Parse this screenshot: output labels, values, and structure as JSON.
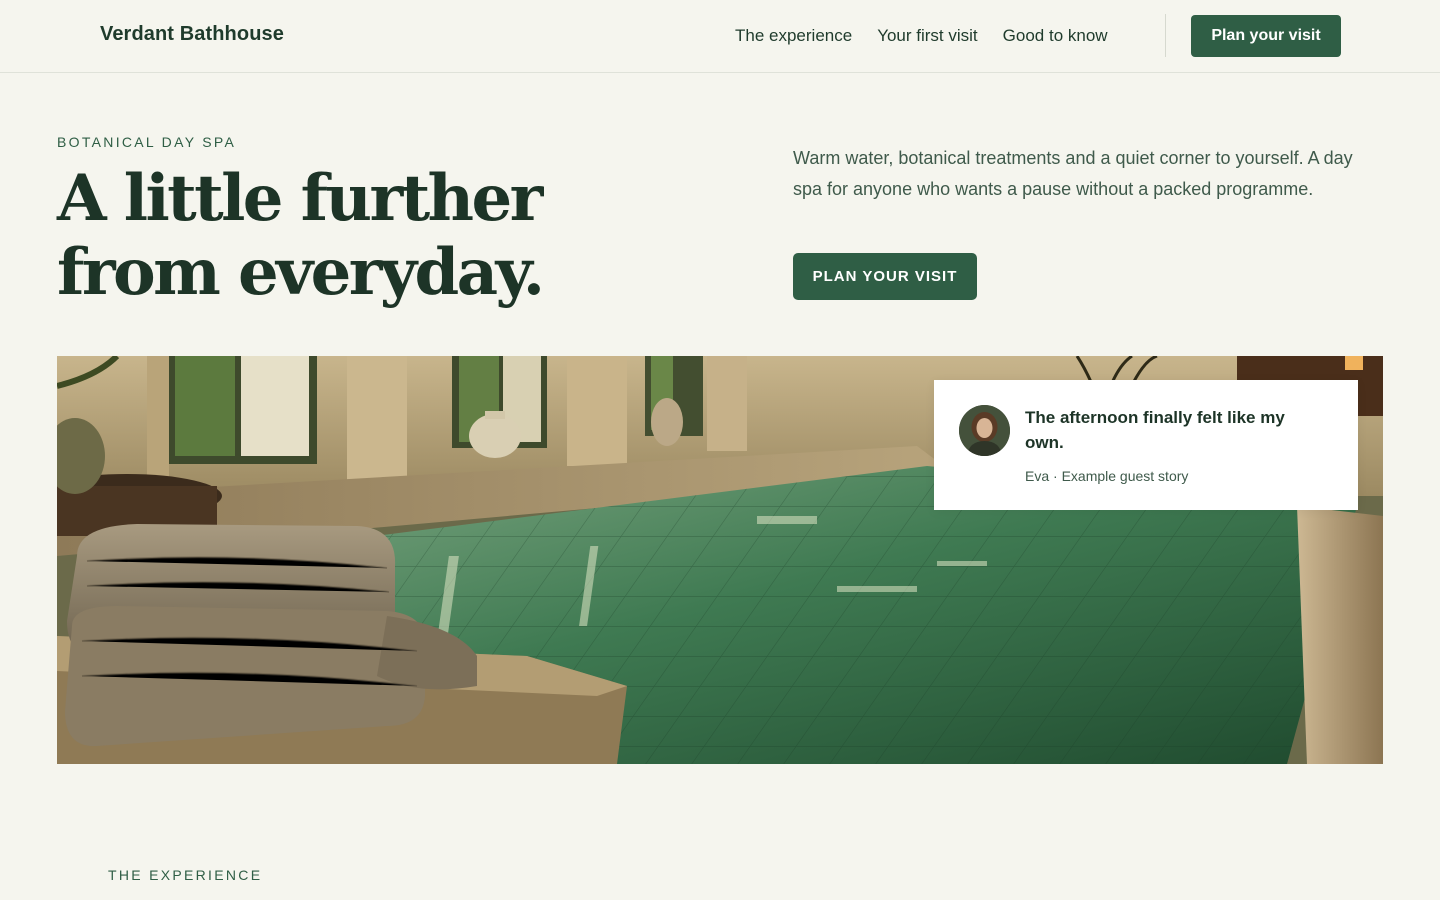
{
  "header": {
    "brand": "Verdant Bathhouse",
    "nav": [
      "The experience",
      "Your first visit",
      "Good to know"
    ],
    "cta_label": "Plan your visit"
  },
  "hero": {
    "eyebrow": "BOTANICAL DAY SPA",
    "title_lines": [
      "A little further",
      "from everyday."
    ],
    "intro": "Warm water, botanical treatments and a quiet corner to yourself. A day spa for anyone who wants a pause without a packed programme.",
    "cta_label": "PLAN YOUR VISIT"
  },
  "testimonial": {
    "quote": "The afternoon finally felt like my own.",
    "attribution": "Eva · Example guest story"
  },
  "next_section": {
    "eyebrow": "THE EXPERIENCE"
  },
  "colors": {
    "background": "#f5f5ee",
    "accent": "#2f5e45",
    "heading": "#1d3427"
  }
}
